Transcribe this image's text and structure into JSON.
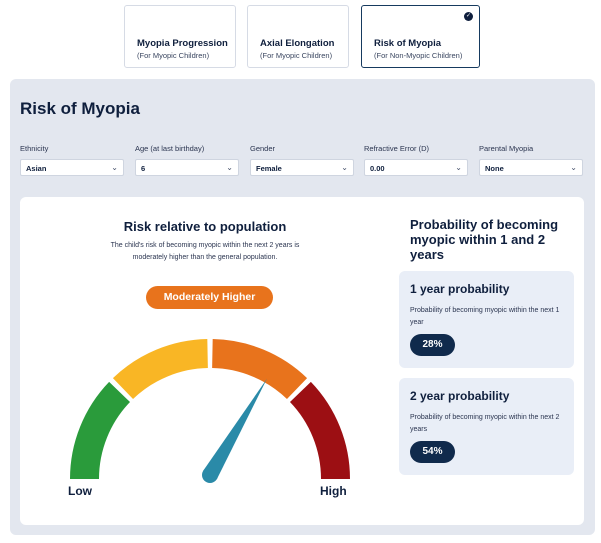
{
  "tabs": [
    {
      "title": "Myopia Progression",
      "subtitle": "(For Myopic Children)",
      "active": false
    },
    {
      "title": "Axial Elongation",
      "subtitle": "(For Myopic Children)",
      "active": false
    },
    {
      "title": "Risk of Myopia",
      "subtitle": "(For Non-Myopic Children)",
      "active": true
    }
  ],
  "panel": {
    "title": "Risk of Myopia"
  },
  "fields": [
    {
      "label": "Ethnicity",
      "value": "Asian"
    },
    {
      "label": "Age (at last birthday)",
      "value": "6"
    },
    {
      "label": "Gender",
      "value": "Female"
    },
    {
      "label": "Refractive Error (D)",
      "value": "0.00"
    },
    {
      "label": "Parental Myopia",
      "value": "None"
    }
  ],
  "risk": {
    "title": "Risk relative to population",
    "description": "The child's risk of becoming myopic within the next 2 years is moderately higher than the general population.",
    "badge": "Moderately Higher",
    "badge_color": "#e8731c",
    "low_label": "Low",
    "high_label": "High",
    "needle_level": 0.67,
    "segment_colors": [
      "#2a9b3b",
      "#f9b625",
      "#e8731c",
      "#9c0f13"
    ],
    "needle_color": "#2a8aa8"
  },
  "probability": {
    "title": "Probability of becoming myopic within 1 and 2 years",
    "items": [
      {
        "heading": "1 year probability",
        "description": "Probability of becoming myopic within the next 1 year",
        "value": "28%"
      },
      {
        "heading": "2 year probability",
        "description": "Probability of becoming myopic within the next 2 years",
        "value": "54%"
      }
    ]
  }
}
